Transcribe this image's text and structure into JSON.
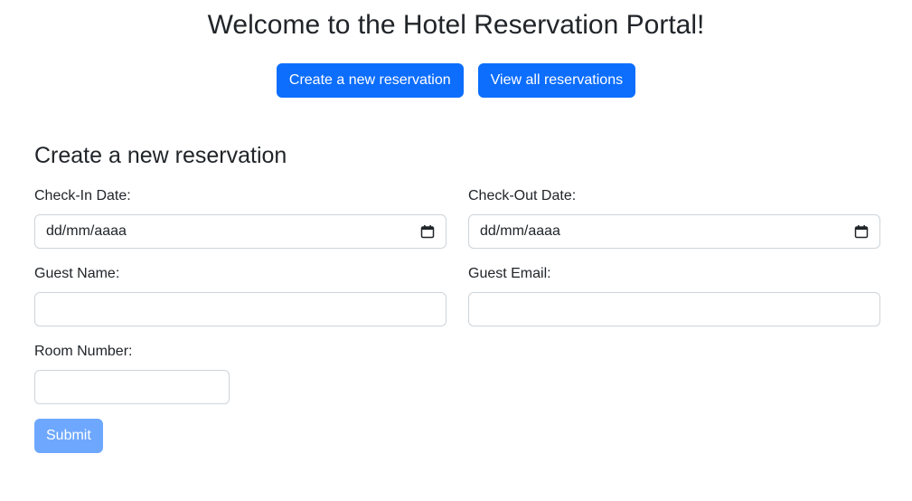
{
  "header": {
    "title": "Welcome to the Hotel Reservation Portal!",
    "create_button": "Create a new reservation",
    "view_button": "View all reservations"
  },
  "form": {
    "title": "Create a new reservation",
    "check_in": {
      "label": "Check-In Date:",
      "value": "dd/mm/aaaa",
      "icon": "calendar-icon"
    },
    "check_out": {
      "label": "Check-Out Date:",
      "value": "dd/mm/aaaa",
      "icon": "calendar-icon"
    },
    "guest_name": {
      "label": "Guest Name:",
      "value": ""
    },
    "guest_email": {
      "label": "Guest Email:",
      "value": ""
    },
    "room_number": {
      "label": "Room Number:",
      "value": ""
    },
    "submit_label": "Submit"
  },
  "colors": {
    "primary": "#0d6efd",
    "primary_disabled": "#6ea8fe",
    "text": "#212529",
    "border": "#ced4da"
  }
}
